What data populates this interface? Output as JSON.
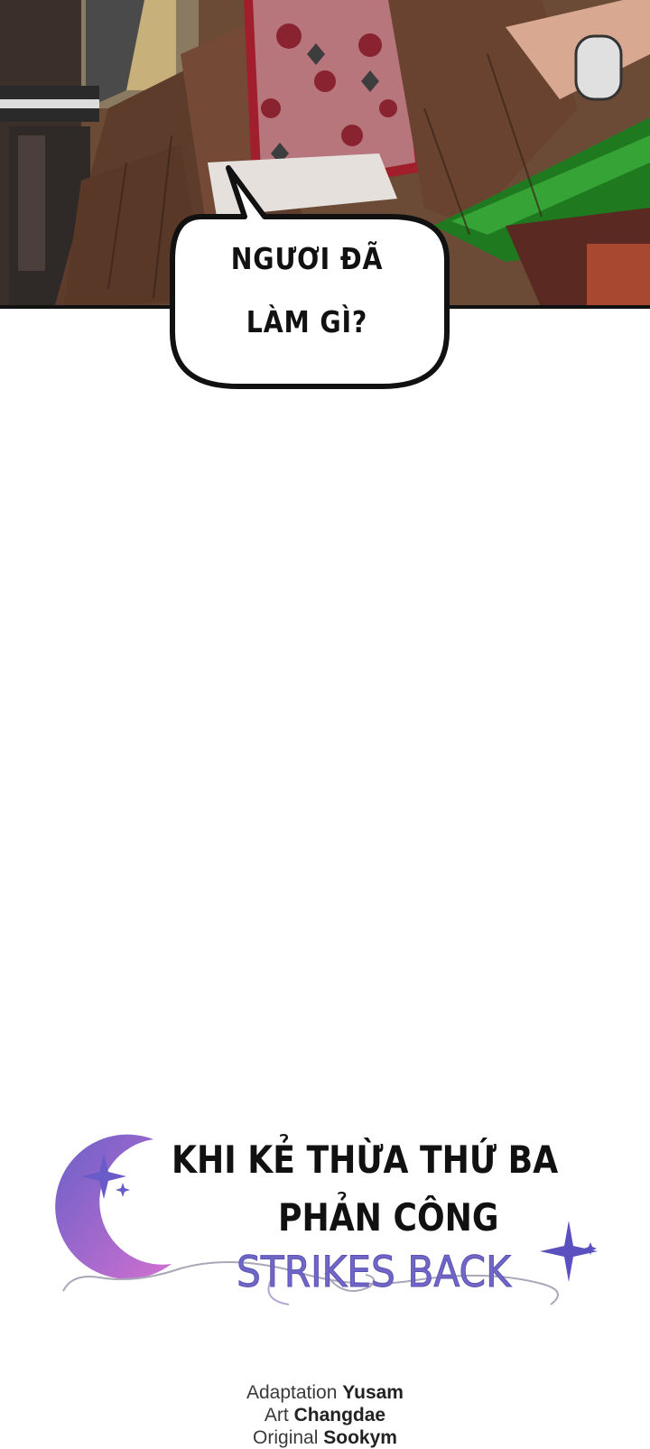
{
  "speech_bubble": {
    "line1": "NGƯƠI ĐÃ",
    "line2": "LÀM GÌ?"
  },
  "title": {
    "vi_line1": "KHI KẺ THỪA THỨ BA",
    "vi_line2": "PHẢN CÔNG",
    "en": "STRIKES BACK",
    "accent_color": "#7066c8"
  },
  "credits": [
    {
      "role": "Adaptation",
      "name": "Yusam"
    },
    {
      "role": "Art",
      "name": "Changdae"
    },
    {
      "role": "Original",
      "name": "Sookym"
    }
  ],
  "colors": {
    "background": "#ffffff",
    "panel_border": "#111111",
    "cloak_brown": "#5a3a2c",
    "green_fabric": "#1f7a1f",
    "floral_red": "#8a2330"
  }
}
